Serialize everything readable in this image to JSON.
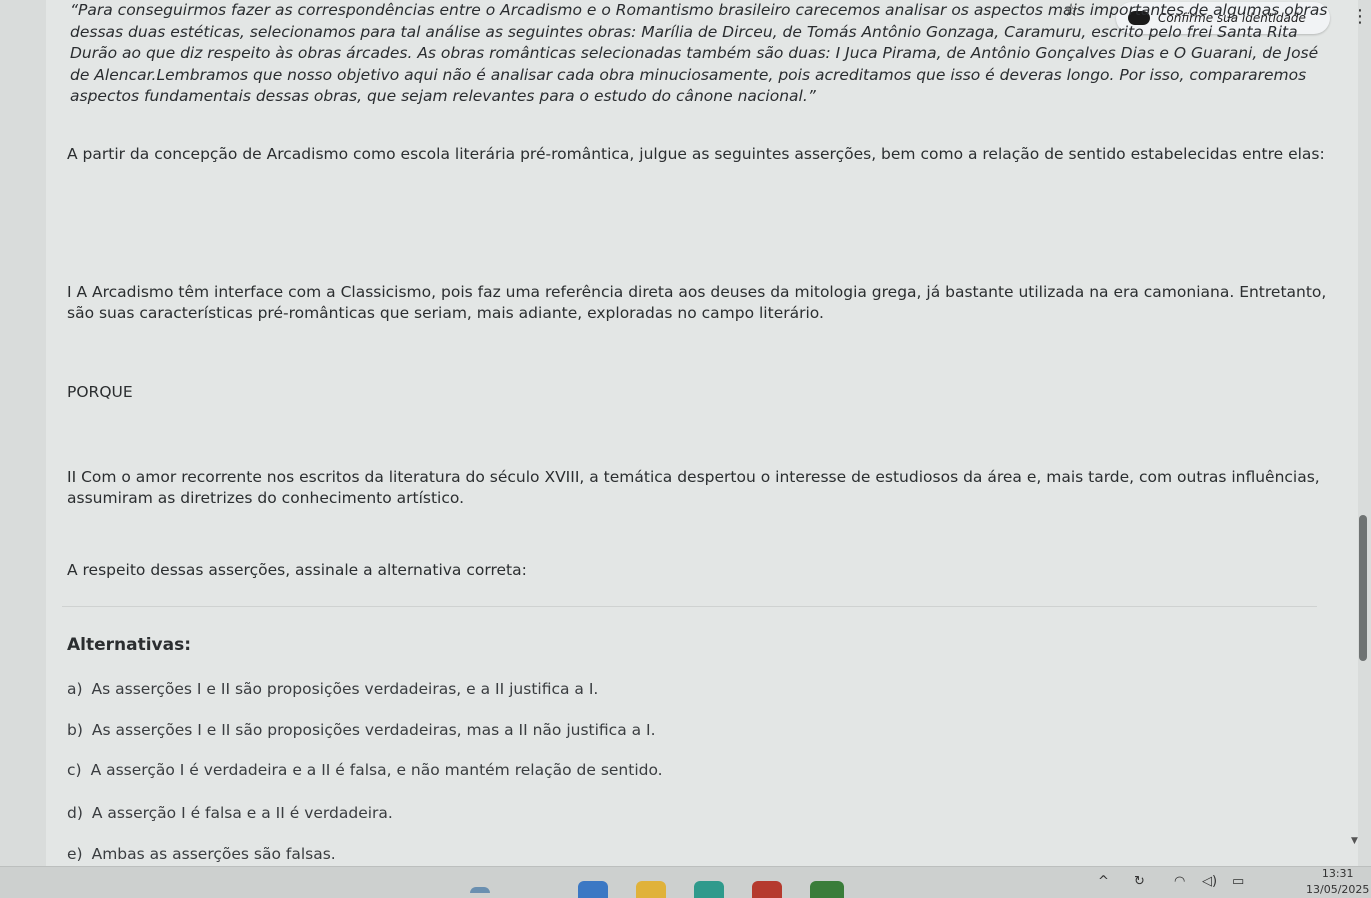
{
  "header": {
    "identity_label": "Confirme sua identidade"
  },
  "question": {
    "quote": "“Para conseguirmos fazer as correspondências entre o Arcadismo e o Romantismo brasileiro carecemos analisar os aspectos mais importantes de algumas obras dessas duas estéticas, selecionamos para tal análise as seguintes obras: Marília de Dirceu, de Tomás Antônio Gonzaga, Caramuru, escrito pelo frei Santa Rita Durão ao que diz respeito às obras árcades. As obras românticas selecionadas também são duas: I Juca Pirama, de Antônio Gonçalves Dias e O Guarani, de José de Alencar.Lembramos que nosso objetivo aqui não é analisar cada obra minuciosamente, pois acreditamos que isso é deveras longo. Por isso, compararemos aspectos fundamentais dessas obras, que sejam relevantes para o estudo do cânone nacional.”",
    "prompt": "A partir da concepção de Arcadismo como escola literária pré-romântica, julgue as seguintes asserções, bem como a relação de sentido estabelecidas entre elas:",
    "assertion_1": "I A Arcadismo têm interface com a Classicismo, pois faz uma referência direta aos deuses da mitologia grega, já bastante utilizada na era camoniana. Entretanto, são suas características pré-românticas que seriam, mais adiante, exploradas no campo literário.",
    "connector": "PORQUE",
    "assertion_2": "II Com o amor recorrente nos escritos da literatura do século XVIII, a temática despertou o interesse de estudiosos da área e, mais tarde, com outras influências, assumiram as diretrizes do conhecimento artístico.",
    "ask": "A respeito dessas asserções, assinale a alternativa correta:"
  },
  "alternatives": {
    "title": "Alternativas:",
    "items": [
      {
        "letter": "a)",
        "text": "As asserções I e II são proposições verdadeiras, e a II justifica a I."
      },
      {
        "letter": "b)",
        "text": "As asserções I e II são proposições verdadeiras, mas a II não justifica a I."
      },
      {
        "letter": "c)",
        "text": "A asserção I é verdadeira e a II é falsa, e não mantém relação de sentido."
      },
      {
        "letter": "d)",
        "text": "A asserção I é falsa e a II é verdadeira."
      },
      {
        "letter": "e)",
        "text": "Ambas as asserções são falsas."
      }
    ]
  },
  "taskbar": {
    "time": "13:31",
    "date": "13/05/2025"
  }
}
